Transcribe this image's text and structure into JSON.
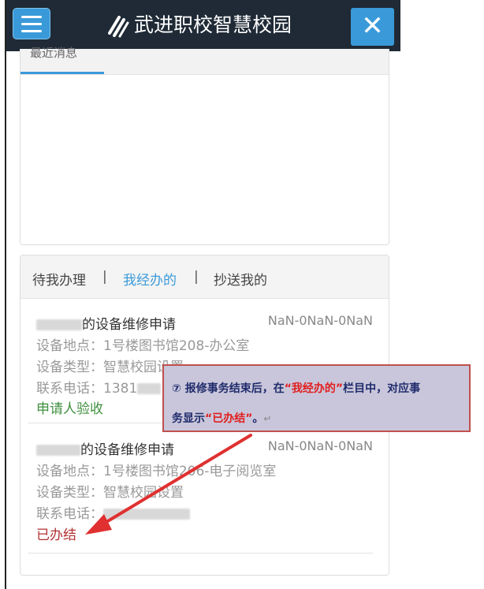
{
  "header": {
    "title": "武进职校智慧校园",
    "close_glyph": "✕"
  },
  "card1": {
    "tab_label": "最近消息"
  },
  "card2": {
    "tabs": [
      {
        "label": "待我办理"
      },
      {
        "label": "我经办的"
      },
      {
        "label": "抄送我的"
      }
    ],
    "separator": "|",
    "items": [
      {
        "title_suffix": "的设备维修申请",
        "date": "NaN-0NaN-0NaN",
        "location": "设备地点：1号楼图书馆208-办公室",
        "type": "设备类型：智慧校园设置",
        "phone": "联系电话：1381",
        "status": "申请人验收"
      },
      {
        "title_suffix": "的设备维修申请",
        "date": "NaN-0NaN-0NaN",
        "location": "设备地点：1号楼图书馆206-电子阅览室",
        "type": "设备类型：智慧校园设置",
        "phone": "联系电话：",
        "status": "已办结"
      }
    ]
  },
  "callout": {
    "line1_a": "⑦  报修事务结束后，在",
    "line1_q": "“我经办的”",
    "line1_b": "栏目中，对应事",
    "line2_a": "务显示",
    "line2_q": "“已办结”",
    "line2_b": "。",
    "para_mark": "↵"
  },
  "colors": {
    "header_bg": "#1f2a36",
    "accent": "#3a9ad9",
    "status_green": "#3f8f3f",
    "status_red": "#b03030",
    "callout_border": "#c0504d",
    "arrow": "#e03030"
  }
}
